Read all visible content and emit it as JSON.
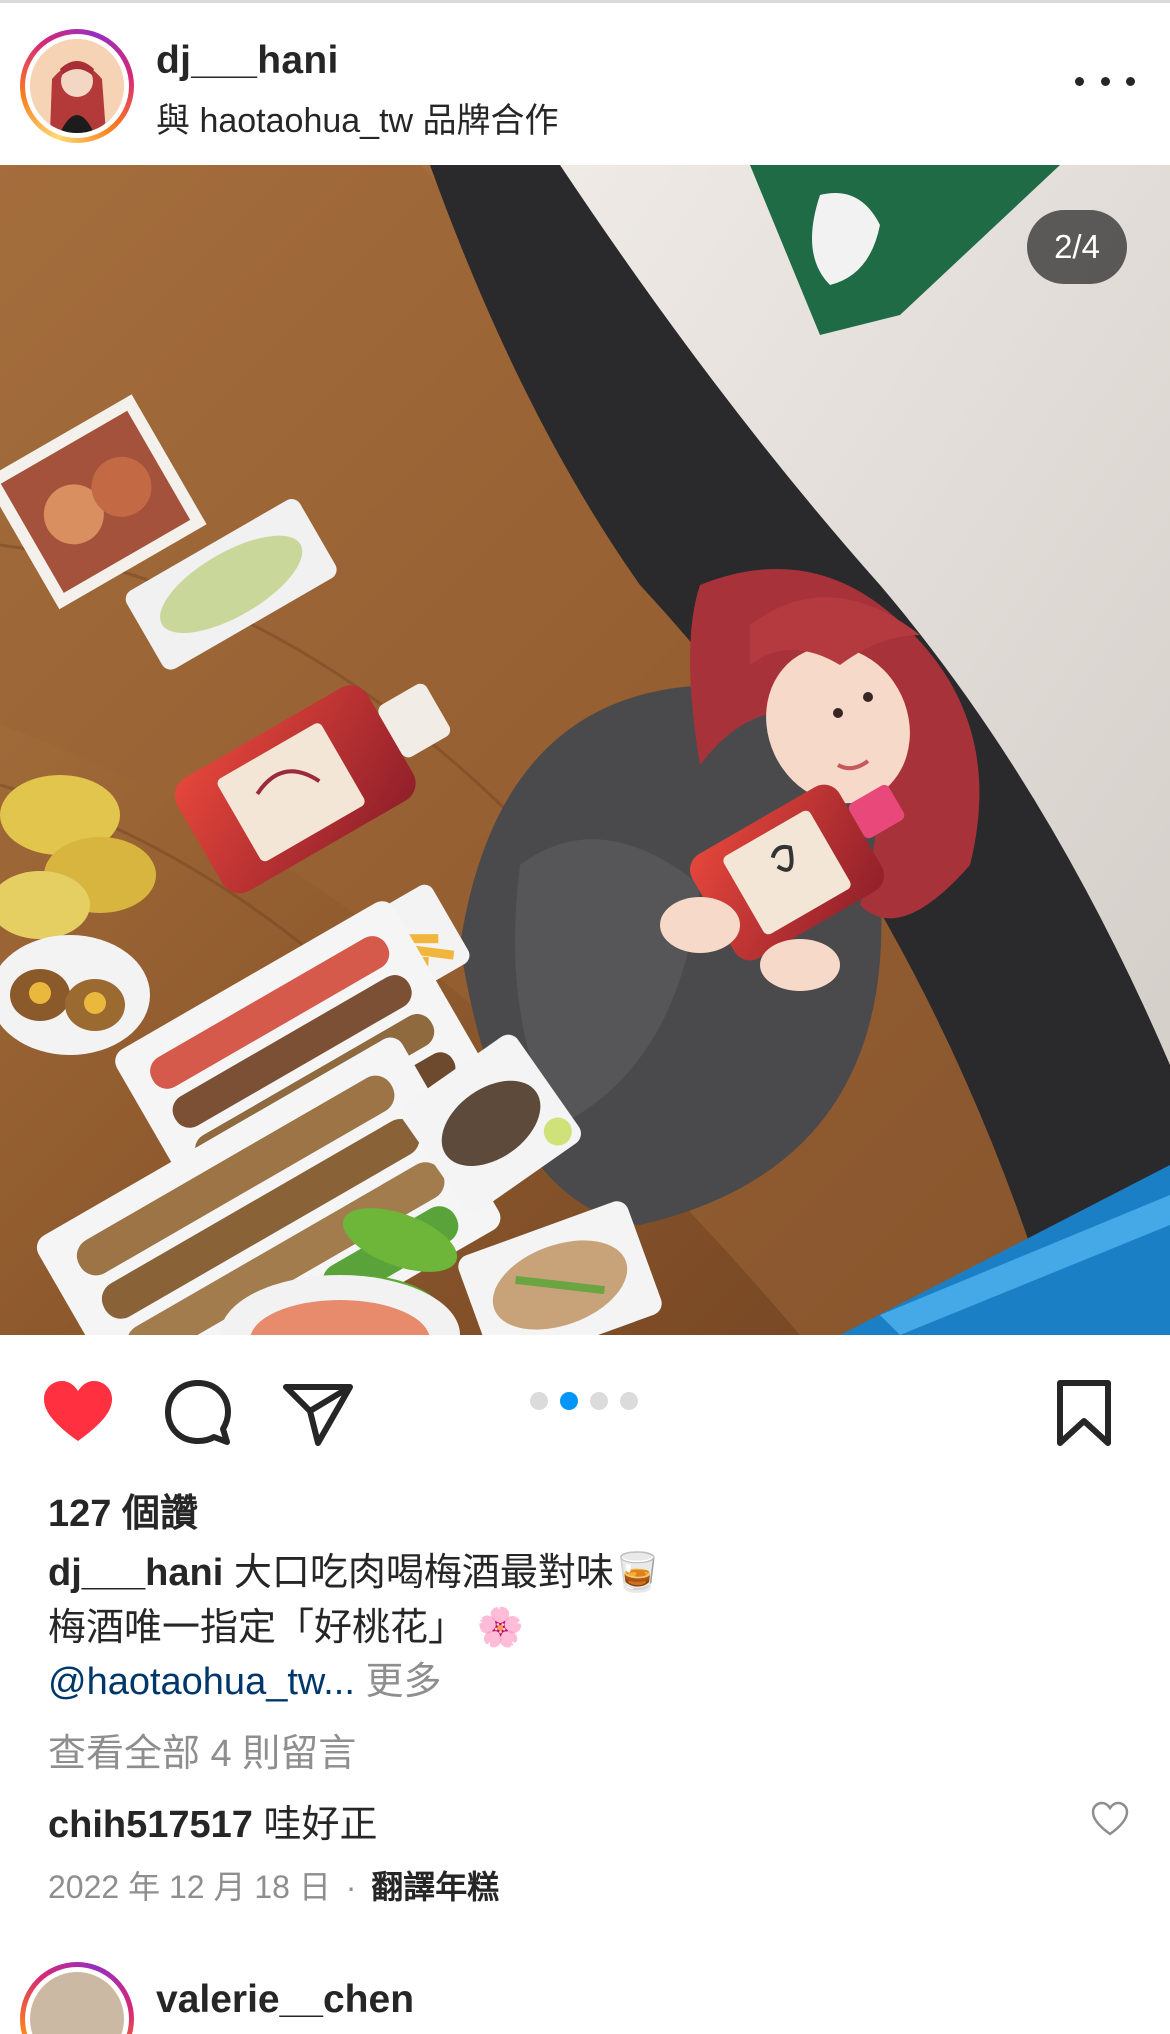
{
  "post": {
    "username": "dj___hani",
    "partnership": "與 haotaohua_tw 品牌合作",
    "image_counter": "2/4",
    "carousel": {
      "total": 4,
      "active_index": 1
    },
    "likes": "127 個讚",
    "caption": {
      "user": "dj___hani",
      "line1": "大口吃肉喝梅酒最對味",
      "line1_emoji": "🥃",
      "line2": "梅酒唯一指定「好桃花」",
      "line2_emoji": "🌸",
      "mention": "@haotaohua_tw...",
      "more": "更多"
    },
    "view_all_comments": "查看全部 4 則留言",
    "top_comment": {
      "user": "chih517517",
      "text": "哇好正"
    },
    "date": "2022 年 12 月 18 日",
    "separator": "·",
    "translate": "翻譯年糕"
  },
  "next_post": {
    "username": "valerie__chen"
  },
  "icons": {
    "like": "heart-filled-icon",
    "comment": "comment-bubble-icon",
    "share": "paper-plane-icon",
    "save": "bookmark-icon",
    "more": "more-horizontal-icon"
  },
  "colors": {
    "like_red": "#ff3040",
    "carousel_active": "#0095f6",
    "mention_blue": "#00376b",
    "muted": "#8e8e8e"
  }
}
